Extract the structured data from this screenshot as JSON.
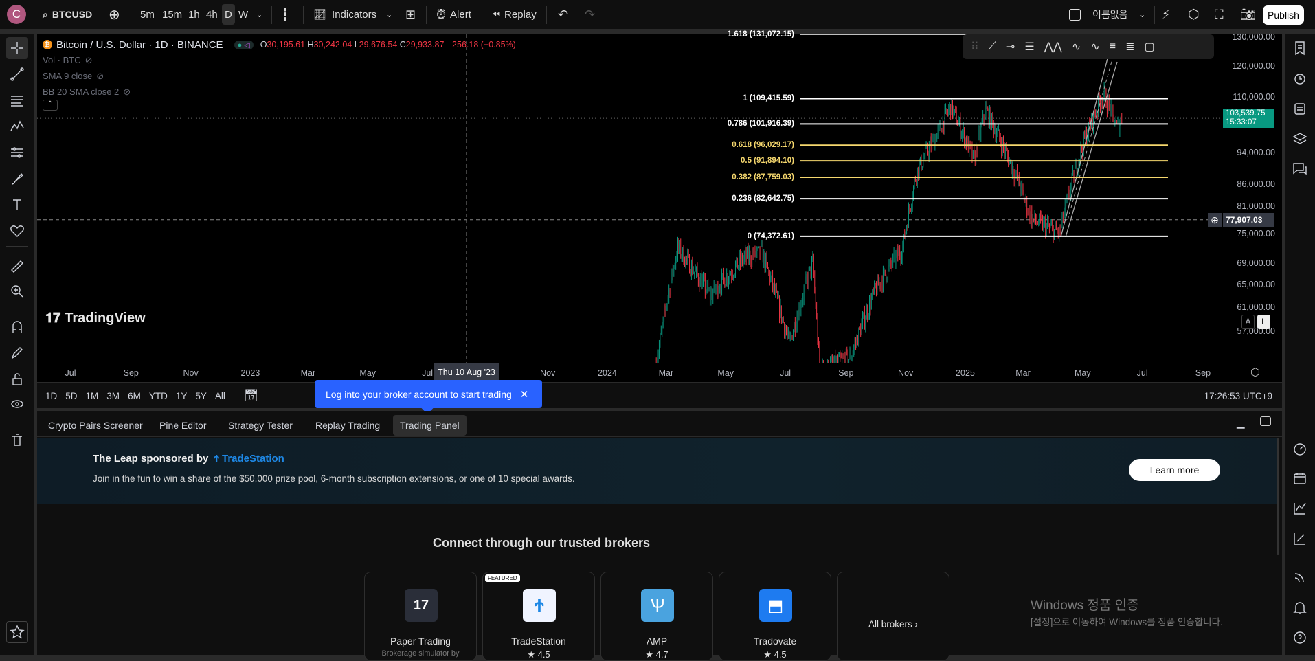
{
  "topbar": {
    "avatar": "C",
    "symbol": "BTCUSD",
    "intervals": [
      "5m",
      "15m",
      "1h",
      "4h",
      "D",
      "W"
    ],
    "active_interval": "D",
    "indicators": "Indicators",
    "alert": "Alert",
    "replay": "Replay",
    "layout_name": "이름없음",
    "publish": "Publish"
  },
  "legend": {
    "title": "Bitcoin / U.S. Dollar · 1D · BINANCE",
    "o_label": "O",
    "o": "30,195.61",
    "h_label": "H",
    "h": "30,242.04",
    "l_label": "L",
    "l": "29,676.54",
    "c_label": "C",
    "c": "29,933.87",
    "change": "-256.18 (−0.85%)",
    "indicators": [
      "Vol · BTC",
      "SMA 9 close",
      "BB 20 SMA close 2"
    ]
  },
  "price_axis": {
    "labels": [
      "130,000.00",
      "120,000.00",
      "110,000.00",
      "94,000.00",
      "86,000.00",
      "81,000.00",
      "75,000.00",
      "69,000.00",
      "65,000.00",
      "61,000.00",
      "57,000.00"
    ],
    "values": [
      130000,
      120000,
      110000,
      94000,
      86000,
      81000,
      75000,
      69000,
      65000,
      61000,
      57000
    ],
    "current_price": "103,539.75",
    "countdown": "15:33:07",
    "crosshair_price": "77,907.03",
    "crosshair_value": 77907.03,
    "current_value": 103539.75,
    "auto_btn": "A",
    "log_btn": "L"
  },
  "time_axis": {
    "labels": [
      "Jul",
      "Sep",
      "Nov",
      "2023",
      "Mar",
      "May",
      "Jul",
      "Nov",
      "2024",
      "Mar",
      "May",
      "Jul",
      "Sep",
      "Nov",
      "2025",
      "Mar",
      "May",
      "Jul",
      "Sep"
    ],
    "dates": [
      "2022-07-01",
      "2022-09-01",
      "2022-11-01",
      "2023-01-01",
      "2023-03-01",
      "2023-05-01",
      "2023-07-01",
      "2023-11-01",
      "2024-01-01",
      "2024-03-01",
      "2024-05-01",
      "2024-07-01",
      "2024-09-01",
      "2024-11-01",
      "2025-01-01",
      "2025-03-01",
      "2025-05-01",
      "2025-07-01",
      "2025-09-01"
    ],
    "crosshair_label": "Thu 10 Aug '23",
    "crosshair_date": "2023-08-10"
  },
  "fib": [
    {
      "label": "1.618 (131,072.15)",
      "value": 131072.15,
      "color": "#ffffff"
    },
    {
      "label": "1 (109,415.59)",
      "value": 109415.59,
      "color": "#ffffff"
    },
    {
      "label": "0.786 (101,916.39)",
      "value": 101916.39,
      "color": "#ffffff"
    },
    {
      "label": "0.618 (96,029.17)",
      "value": 96029.17,
      "color": "#f5d76e"
    },
    {
      "label": "0.5 (91,894.10)",
      "value": 91894.1,
      "color": "#f5d76e"
    },
    {
      "label": "0.382 (87,759.03)",
      "value": 87759.03,
      "color": "#f5d76e"
    },
    {
      "label": "0.236 (82,642.75)",
      "value": 82642.75,
      "color": "#ffffff"
    },
    {
      "label": "0 (74,372.61)",
      "value": 74372.61,
      "color": "#ffffff"
    }
  ],
  "chart_data": {
    "type": "candlestick",
    "symbol": "BTCUSD",
    "price_path": [
      [
        "2024-02-20",
        52000
      ],
      [
        "2024-03-13",
        72000
      ],
      [
        "2024-04-15",
        63000
      ],
      [
        "2024-05-20",
        70000
      ],
      [
        "2024-06-07",
        71000
      ],
      [
        "2024-07-05",
        55000
      ],
      [
        "2024-07-29",
        69000
      ],
      [
        "2024-08-05",
        51000
      ],
      [
        "2024-09-06",
        53000
      ],
      [
        "2024-10-01",
        64000
      ],
      [
        "2024-10-29",
        72000
      ],
      [
        "2024-11-12",
        89000
      ],
      [
        "2024-12-05",
        100000
      ],
      [
        "2024-12-17",
        107000
      ],
      [
        "2025-01-10",
        92000
      ],
      [
        "2025-01-22",
        106000
      ],
      [
        "2025-02-25",
        86000
      ],
      [
        "2025-03-10",
        78000
      ],
      [
        "2025-04-07",
        75000
      ],
      [
        "2025-05-02",
        97000
      ],
      [
        "2025-05-22",
        111000
      ],
      [
        "2025-06-05",
        101000
      ],
      [
        "2025-06-10",
        103539
      ]
    ],
    "colors": {
      "up": "#089981",
      "down": "#f23645"
    }
  },
  "watermark": "TradingView",
  "range": {
    "buttons": [
      "1D",
      "5D",
      "1M",
      "3M",
      "6M",
      "YTD",
      "1Y",
      "5Y",
      "All"
    ],
    "clock": "17:26:53 UTC+9"
  },
  "popover": {
    "text": "Log into your broker account to start trading"
  },
  "bottom": {
    "tabs": [
      "Crypto Pairs Screener",
      "Pine Editor",
      "Strategy Tester",
      "Replay Trading",
      "Trading Panel"
    ],
    "active_tab": "Trading Panel",
    "banner": {
      "title": "The Leap sponsored by",
      "brand": "TradeStation",
      "text": "Join in the fun to win a share of the $50,000 prize pool, 6-month subscription extensions, or one of 10 special awards.",
      "button": "Learn more"
    },
    "heading": "Connect through our trusted brokers",
    "brokers": [
      {
        "name": "Paper Trading",
        "sub": "Brokerage simulator by",
        "badge": ""
      },
      {
        "name": "TradeStation",
        "rating": "4.5",
        "badge": "FEATURED"
      },
      {
        "name": "AMP",
        "rating": "4.7",
        "badge": ""
      },
      {
        "name": "Tradovate",
        "rating": "4.5",
        "badge": ""
      }
    ],
    "all_brokers": "All brokers ›"
  },
  "windows": {
    "line1": "Windows 정품 인증",
    "line2": "[설정]으로 이동하여 Windows를 정품 인증합니다."
  }
}
